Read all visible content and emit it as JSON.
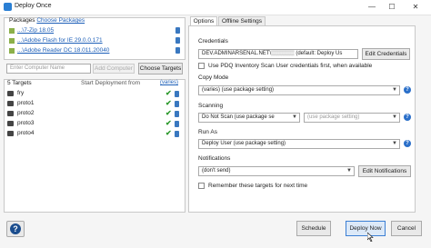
{
  "window": {
    "title": "Deploy Once",
    "minimize": "—",
    "maximize": "☐",
    "close": "✕"
  },
  "packages": {
    "label": "Packages",
    "choose_link": "Choose Packages",
    "items": [
      {
        "name": "...\\7-Zip 18.05"
      },
      {
        "name": "...\\Adobe Flash for IE 29.0.0.171"
      },
      {
        "name": "...\\Adobe Reader DC 18.011.20040"
      }
    ]
  },
  "computer_input": {
    "placeholder": "Enter Computer Name",
    "add_label": "Add Computer"
  },
  "choose_targets_label": "Choose Targets",
  "targets": {
    "count_label": "5 Targets",
    "start_label": "Start Deployment from",
    "varies_link": "(varies)",
    "items": [
      {
        "name": "fry"
      },
      {
        "name": "proto1"
      },
      {
        "name": "proto2"
      },
      {
        "name": "proto3"
      },
      {
        "name": "proto4"
      }
    ]
  },
  "tabs": [
    {
      "label": "Options"
    },
    {
      "label": "Offline Settings"
    }
  ],
  "options": {
    "credentials_label": "Credentials",
    "credentials_value": "DEV.ADMINARSENAL.NET\\",
    "credentials_value_2": " (default: Deploy Us",
    "edit_credentials": "Edit Credentials",
    "use_pdq_label": "Use PDQ Inventory Scan User credentials first, when available",
    "copy_mode_label": "Copy Mode",
    "copy_mode_value": "(varies) (use package setting)",
    "scanning_label": "Scanning",
    "scanning_value": "Do Not Scan (use package se",
    "scanning_value_2": "(use package setting)",
    "run_as_label": "Run As",
    "run_as_value": "Deploy User (use package setting)",
    "notifications_label": "Notifications",
    "notifications_value": "(don't send)",
    "edit_notifications": "Edit Notifications",
    "remember_label": "Remember these targets for next time"
  },
  "footer": {
    "help": "?",
    "schedule": "Schedule",
    "deploy_now": "Deploy Now",
    "cancel": "Cancel"
  }
}
